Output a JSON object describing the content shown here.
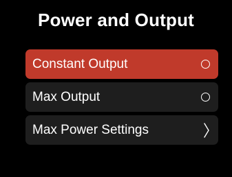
{
  "screen": {
    "title": "Power and Output"
  },
  "menu": {
    "items": [
      {
        "label": "Constant Output",
        "indicator": "radio-icon",
        "selected": true
      },
      {
        "label": "Max Output",
        "indicator": "radio-icon",
        "selected": false
      },
      {
        "label": "Max Power Settings",
        "indicator": "chevron-right-icon",
        "selected": false
      }
    ]
  },
  "colors": {
    "background": "#000000",
    "item_background": "#1e1e1e",
    "selected_background": "#c03a2b",
    "text": "#ffffff"
  }
}
